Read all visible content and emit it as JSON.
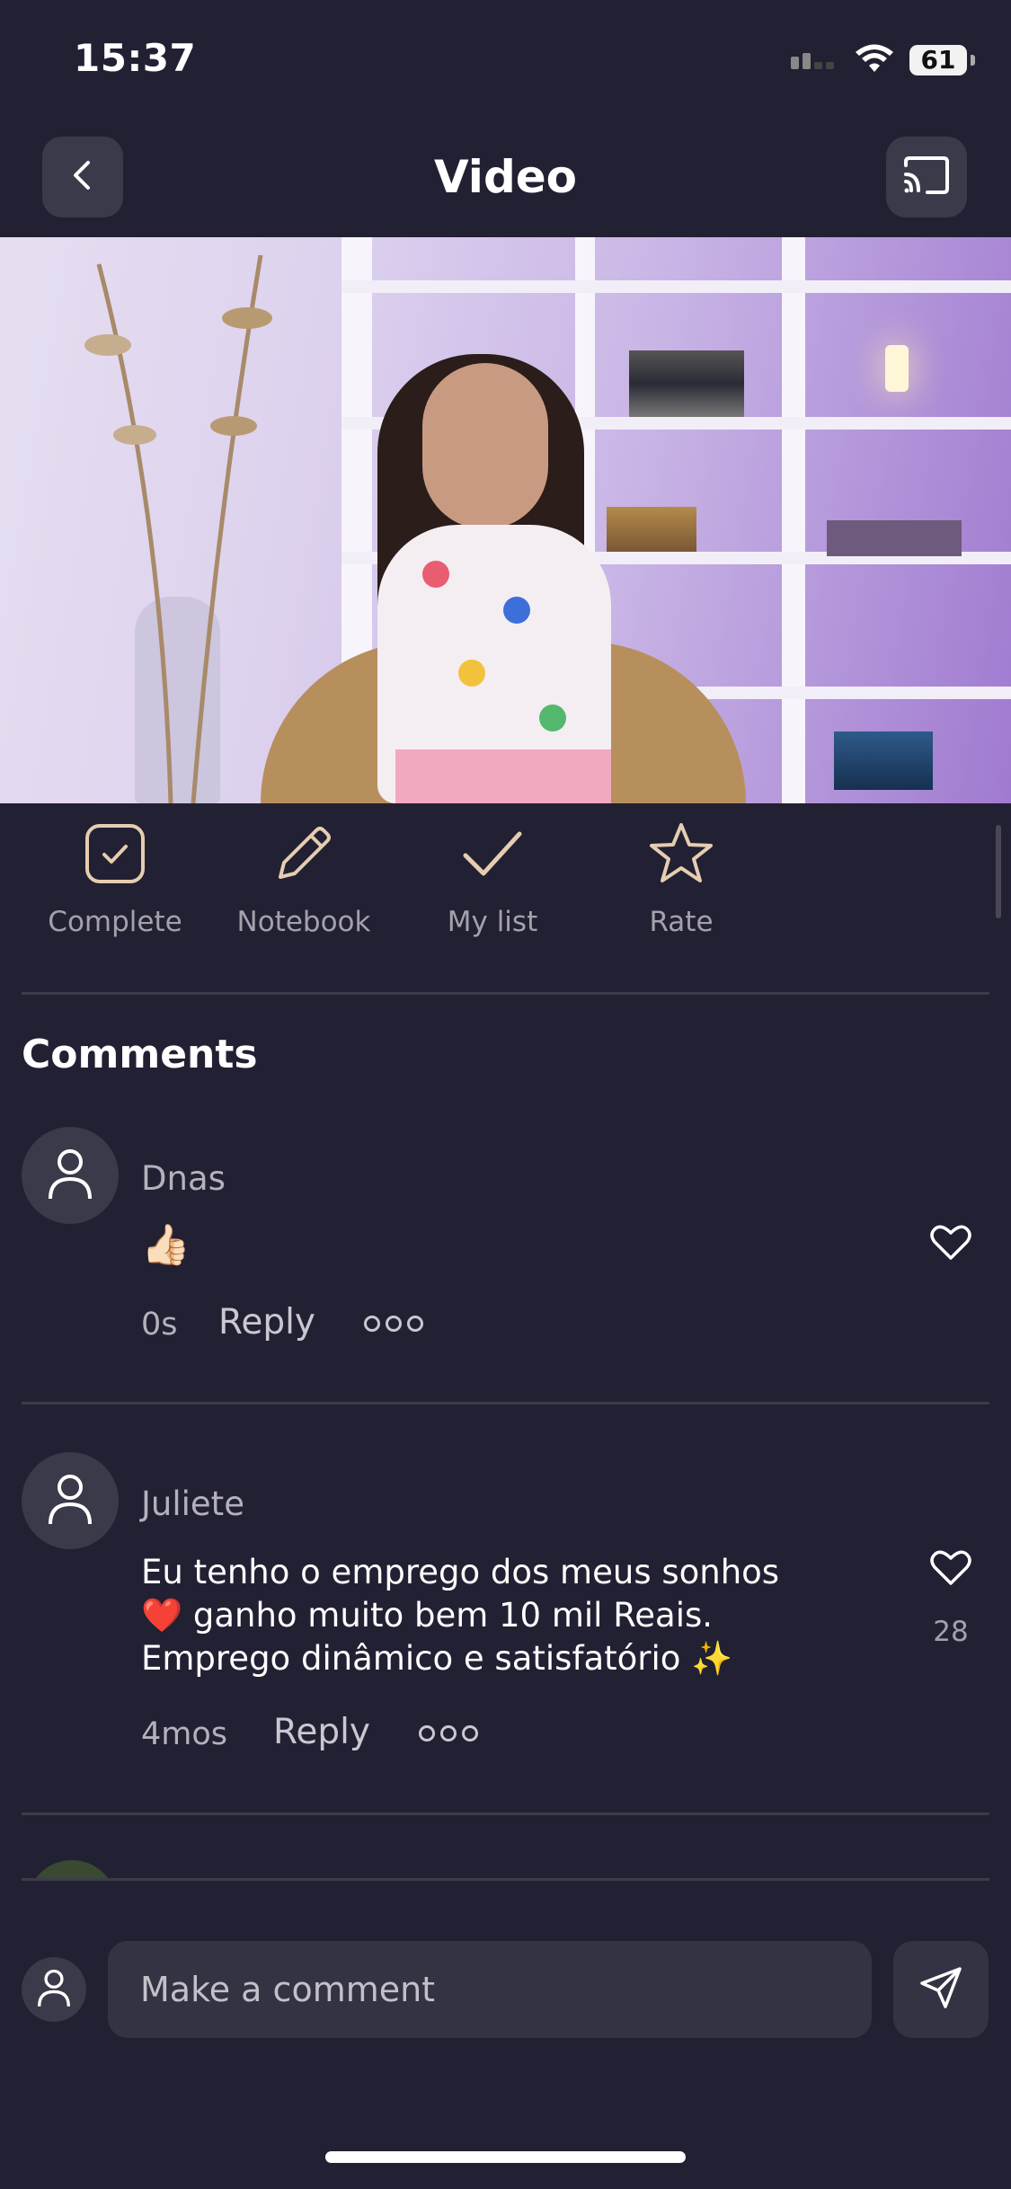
{
  "status_bar": {
    "time": "15:37",
    "battery": "61"
  },
  "header": {
    "title": "Video",
    "back_icon": "chevron-left-icon",
    "cast_icon": "cast-icon"
  },
  "video": {
    "description": ""
  },
  "actions": [
    {
      "label": "Complete",
      "icon": "checkbox-icon"
    },
    {
      "label": "Notebook",
      "icon": "pencil-icon"
    },
    {
      "label": "My list",
      "icon": "checkmark-icon"
    },
    {
      "label": "Rate",
      "icon": "star-icon"
    }
  ],
  "comments": {
    "title": "Comments",
    "items": [
      {
        "user": "Dnas",
        "text": "👍🏻",
        "age": "0s",
        "reply": "Reply",
        "likes": ""
      },
      {
        "user": "Juliete",
        "line1": "Eu tenho o emprego dos meus sonhos",
        "line2": "❤️ ganho muito bem 10 mil Reais.",
        "line3": "Emprego dinâmico e satisfatório ✨",
        "age": "4mos",
        "reply": "Reply",
        "likes": "28"
      }
    ]
  },
  "composer": {
    "placeholder": "Make a comment"
  },
  "colors": {
    "background": "#222033",
    "accent": "#e6cdb0",
    "surface": "#343343"
  }
}
